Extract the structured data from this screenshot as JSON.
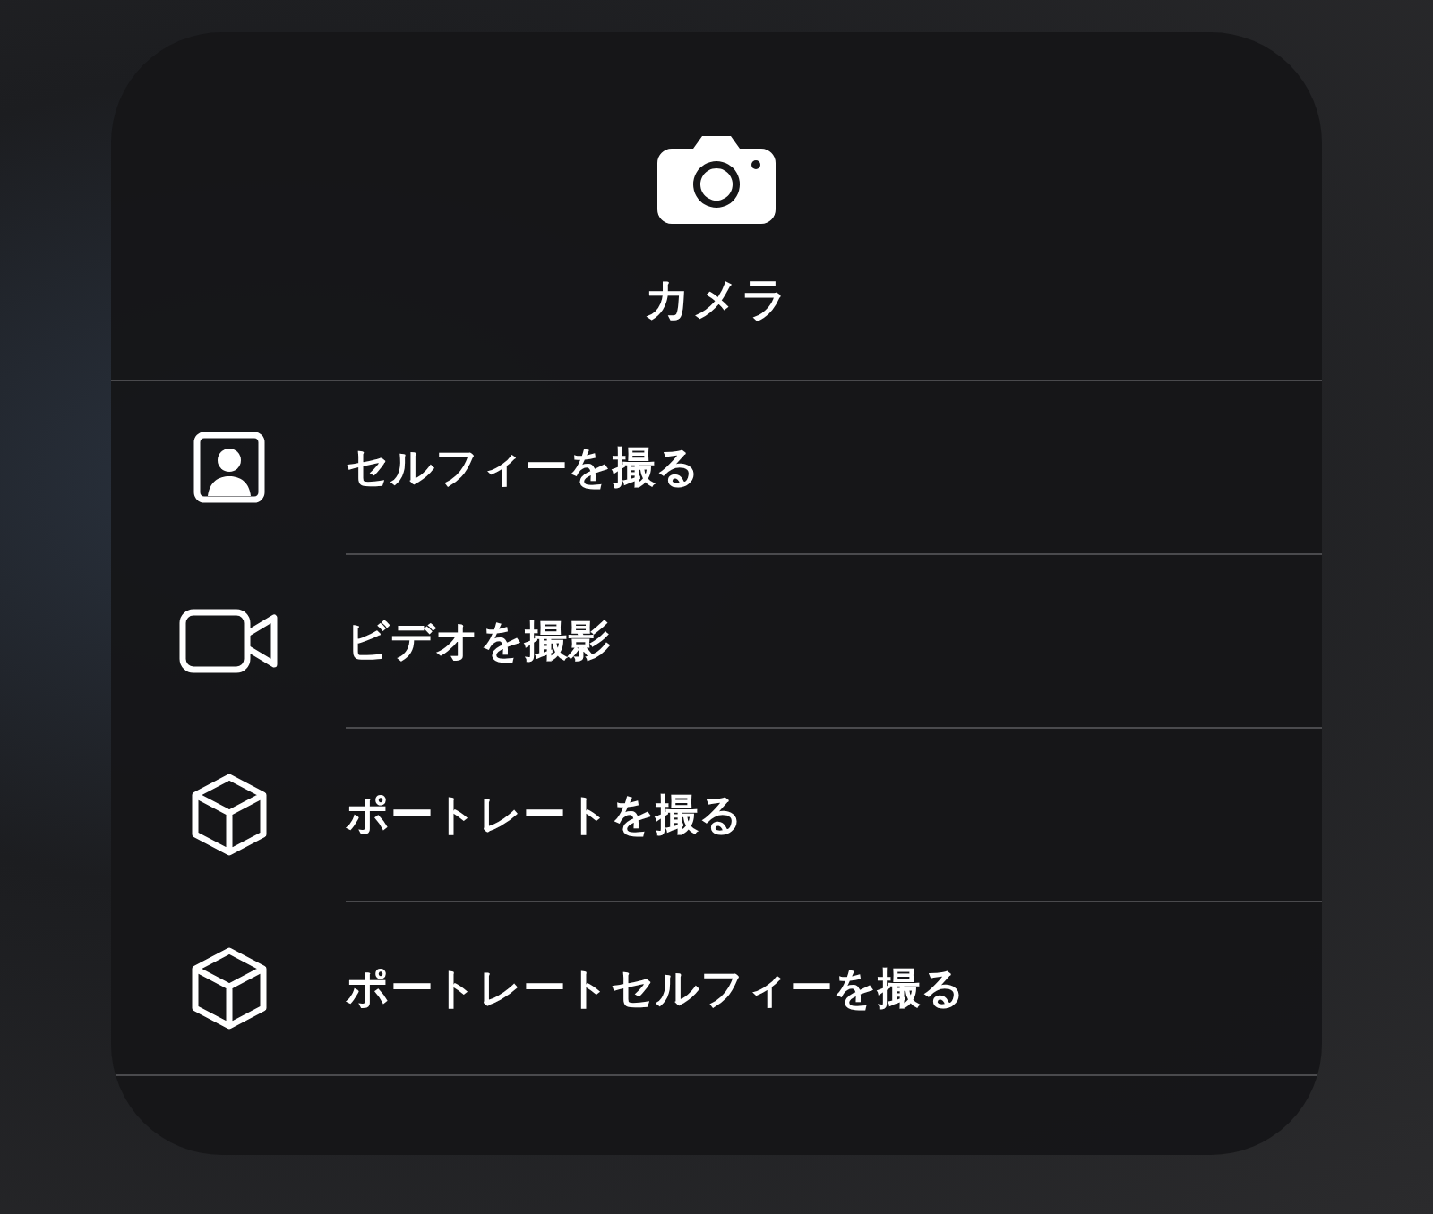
{
  "app": {
    "title": "カメラ"
  },
  "actions": [
    {
      "kind": "portrait",
      "label": "セルフィーを撮る"
    },
    {
      "kind": "video",
      "label": "ビデオを撮影"
    },
    {
      "kind": "cube",
      "label": "ポートレートを撮る"
    },
    {
      "kind": "cube",
      "label": "ポートレートセルフィーを撮る"
    }
  ]
}
